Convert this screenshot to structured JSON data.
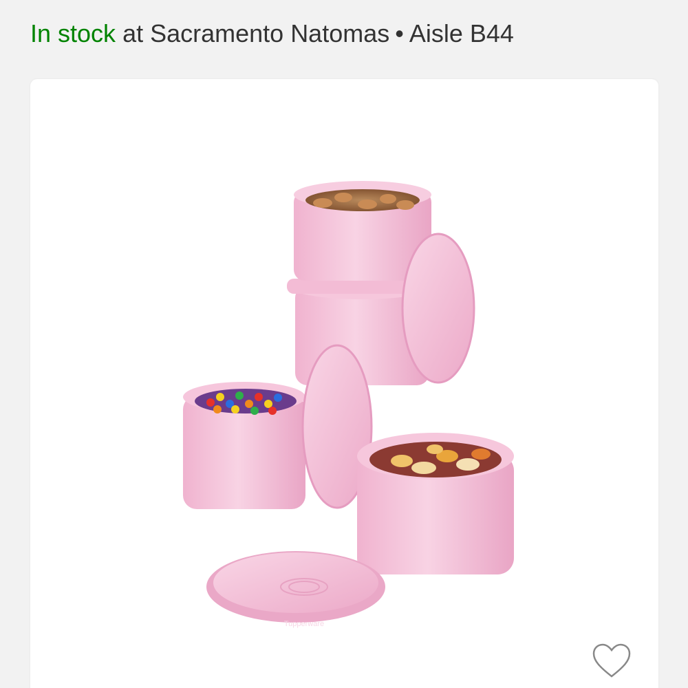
{
  "stock": {
    "status": "In stock",
    "location_text": "at Sacramento Natomas",
    "separator": "•",
    "aisle": "Aisle B44"
  },
  "product": {
    "image_brand_text": "Tupperware"
  },
  "colors": {
    "in_stock_green": "#008300",
    "container_pink": "#f3b6d3",
    "text_dark": "#333333",
    "heart_outline": "#888888"
  },
  "icons": {
    "favorite": "heart-outline-icon"
  }
}
